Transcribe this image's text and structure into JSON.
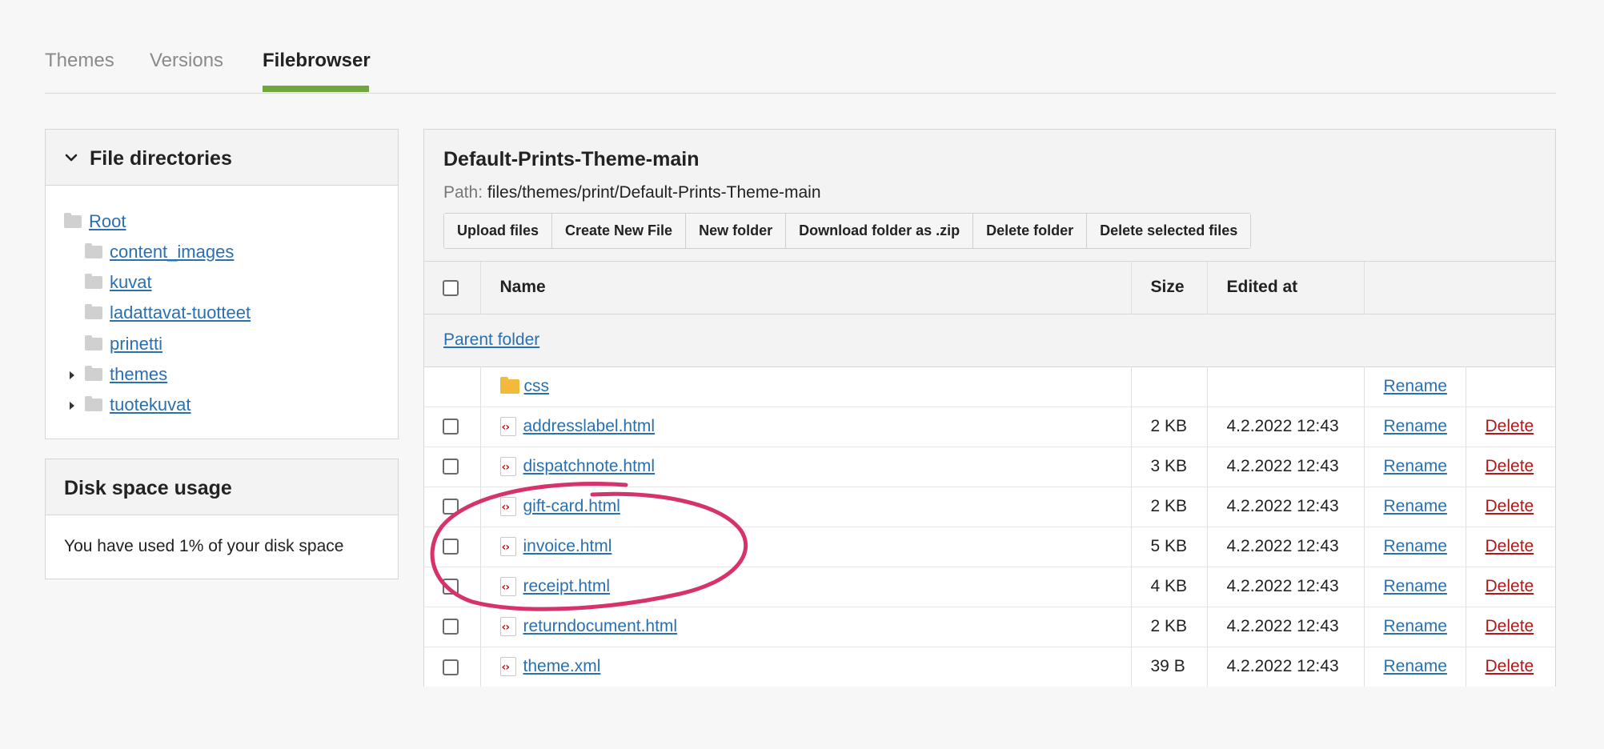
{
  "tabs": [
    {
      "label": "Themes"
    },
    {
      "label": "Versions"
    },
    {
      "label": "Filebrowser"
    }
  ],
  "sidebar": {
    "directories_title": "File directories",
    "tree": [
      {
        "label": "Root"
      },
      {
        "label": "content_images"
      },
      {
        "label": "kuvat"
      },
      {
        "label": "ladattavat-tuotteet"
      },
      {
        "label": "prinetti"
      },
      {
        "label": "themes"
      },
      {
        "label": "tuotekuvat"
      }
    ],
    "disk_title": "Disk space usage",
    "disk_text": "You have used 1% of your disk space"
  },
  "main": {
    "title": "Default-Prints-Theme-main",
    "path_label": "Path:",
    "path_value": "files/themes/print/Default-Prints-Theme-main",
    "buttons": [
      {
        "label": "Upload files"
      },
      {
        "label": "Create New File"
      },
      {
        "label": "New folder"
      },
      {
        "label": "Download folder as .zip"
      },
      {
        "label": "Delete folder"
      },
      {
        "label": "Delete selected files"
      }
    ],
    "columns": {
      "name": "Name",
      "size": "Size",
      "edited": "Edited at"
    },
    "parent_folder": "Parent folder",
    "rename_label": "Rename",
    "delete_label": "Delete",
    "folder_row": {
      "name": "css"
    },
    "files": [
      {
        "name": "addresslabel.html",
        "size": "2 KB",
        "edited": "4.2.2022 12:43"
      },
      {
        "name": "dispatchnote.html",
        "size": "3 KB",
        "edited": "4.2.2022 12:43"
      },
      {
        "name": "gift-card.html",
        "size": "2 KB",
        "edited": "4.2.2022 12:43"
      },
      {
        "name": "invoice.html",
        "size": "5 KB",
        "edited": "4.2.2022 12:43"
      },
      {
        "name": "receipt.html",
        "size": "4 KB",
        "edited": "4.2.2022 12:43"
      },
      {
        "name": "returndocument.html",
        "size": "2 KB",
        "edited": "4.2.2022 12:43"
      },
      {
        "name": "theme.xml",
        "size": "39 B",
        "edited": "4.2.2022 12:43"
      }
    ]
  },
  "colors": {
    "accent": "#71a53d",
    "link": "#2a70b0",
    "delete": "#b01818",
    "annotation": "#d6336c"
  }
}
